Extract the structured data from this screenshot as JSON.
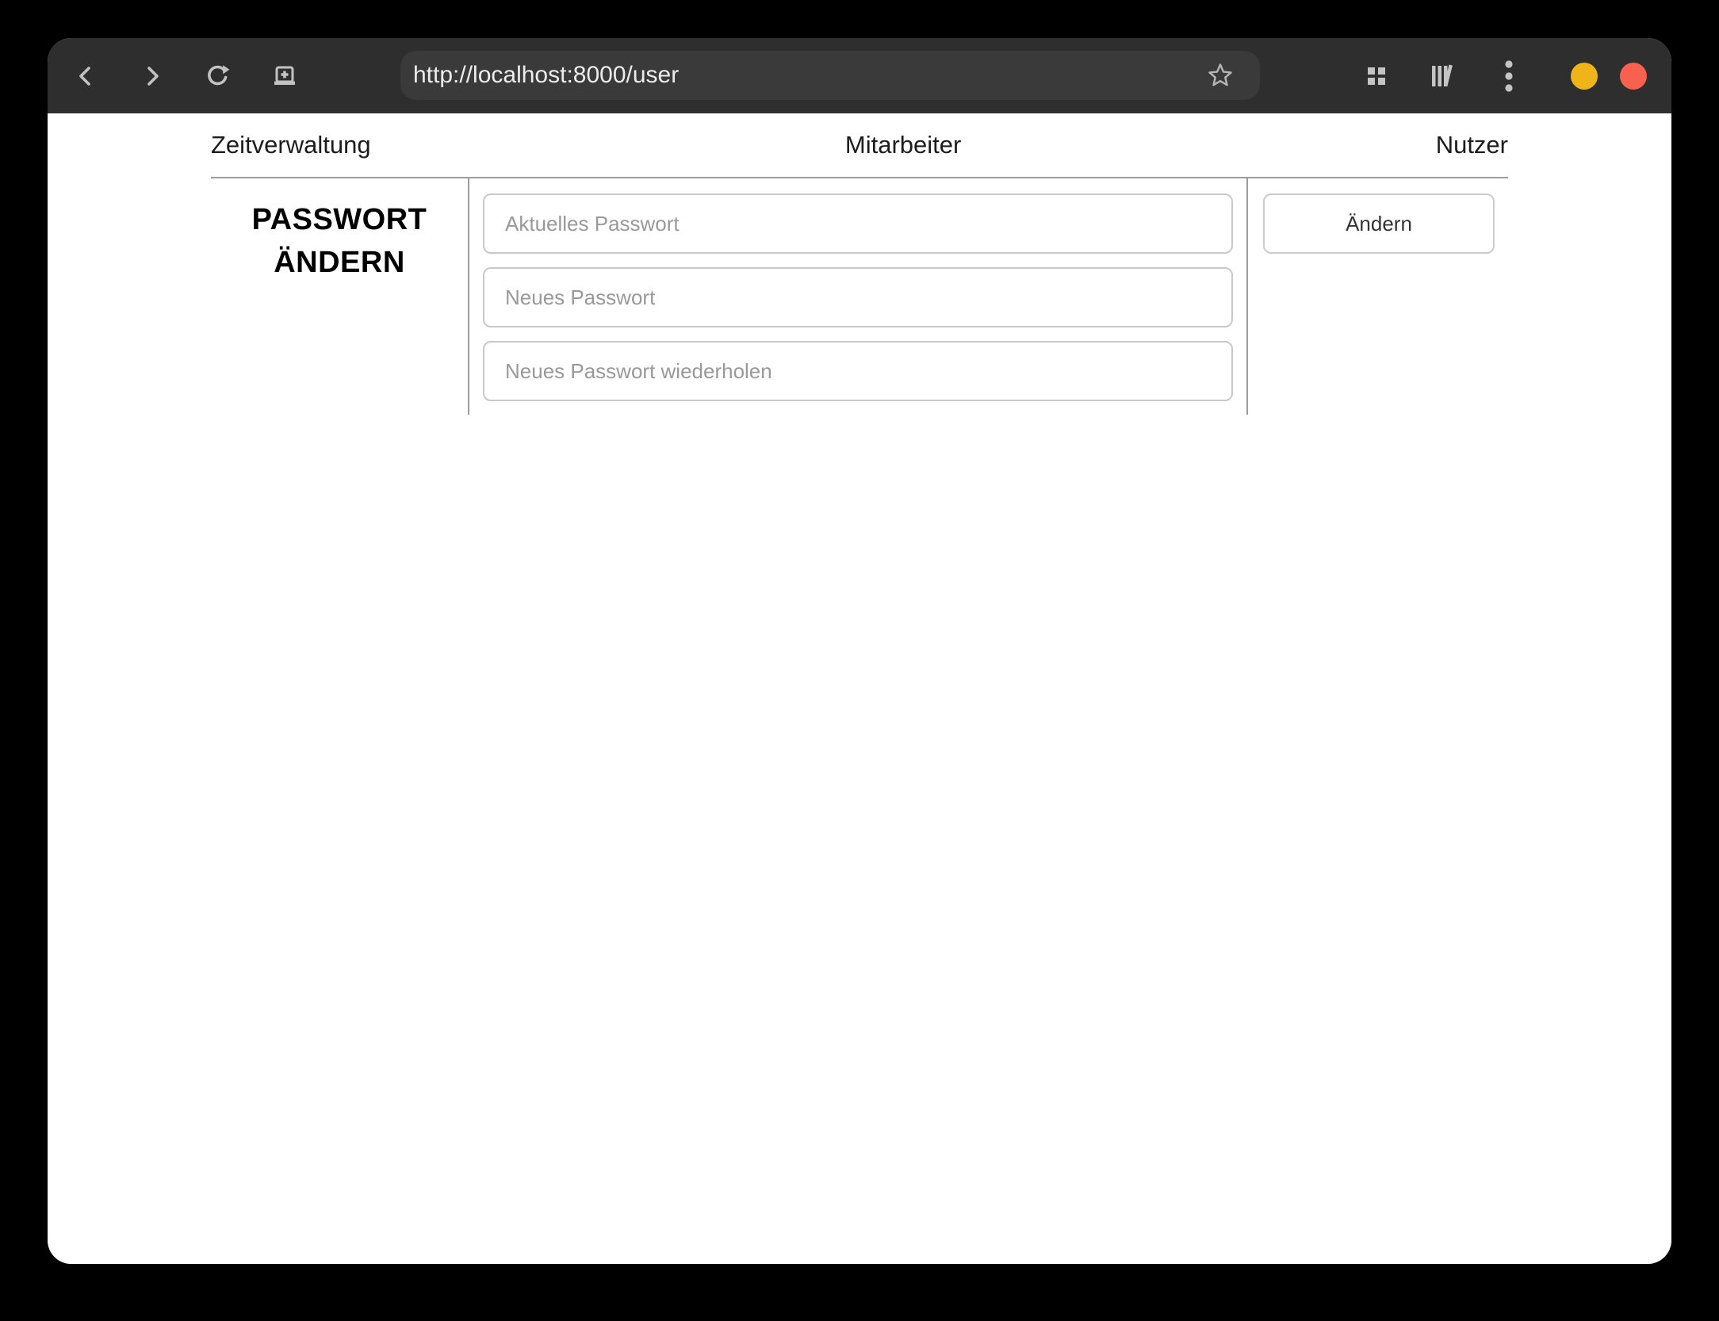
{
  "browser": {
    "url": "http://localhost:8000/user"
  },
  "nav": {
    "items": [
      {
        "label": "Zeitverwaltung"
      },
      {
        "label": "Mitarbeiter"
      },
      {
        "label": "Nutzer"
      }
    ]
  },
  "password_section": {
    "heading_line1": "PASSWORT",
    "heading_line2": "ÄNDERN",
    "fields": [
      {
        "placeholder": "Aktuelles Passwort"
      },
      {
        "placeholder": "Neues Passwort"
      },
      {
        "placeholder": "Neues Passwort wiederholen"
      }
    ],
    "submit_label": "Ändern"
  },
  "colors": {
    "toolbar_bg": "#2e2e2e",
    "urlbar_bg": "#3a3a3a",
    "icon_gray": "#c2c2c2",
    "divider_gray": "#9c9c9c",
    "minimize_yellow": "#f0b41b",
    "close_red": "#f7614d"
  }
}
